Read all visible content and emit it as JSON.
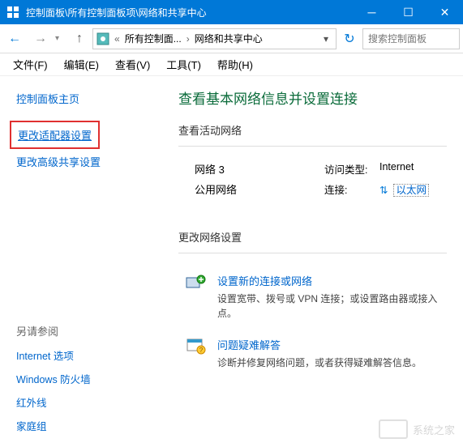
{
  "titlebar": {
    "title": "控制面板\\所有控制面板项\\网络和共享中心"
  },
  "nav": {
    "breadcrumb_part1": "所有控制面...",
    "breadcrumb_part2": "网络和共享中心",
    "search_placeholder": "搜索控制面板"
  },
  "menubar": {
    "file": "文件(F)",
    "edit": "编辑(E)",
    "view": "查看(V)",
    "tools": "工具(T)",
    "help": "帮助(H)"
  },
  "sidebar": {
    "home": "控制面板主页",
    "adapter": "更改适配器设置",
    "advanced": "更改高级共享设置",
    "see_also": "另请参阅",
    "items": [
      "Internet 选项",
      "Windows 防火墙",
      "红外线",
      "家庭组"
    ]
  },
  "main": {
    "title": "查看基本网络信息并设置连接",
    "active_label": "查看活动网络",
    "network": {
      "name": "网络  3",
      "type": "公用网络",
      "access_label": "访问类型:",
      "access_value": "Internet",
      "conn_label": "连接:",
      "conn_value": "以太网"
    },
    "change_label": "更改网络设置",
    "setup": {
      "title": "设置新的连接或网络",
      "desc": "设置宽带、拨号或 VPN 连接；或设置路由器或接入点。"
    },
    "troubleshoot": {
      "title": "问题疑难解答",
      "desc": "诊断并修复网络问题，或者获得疑难解答信息。"
    }
  },
  "watermark": "系统之家"
}
